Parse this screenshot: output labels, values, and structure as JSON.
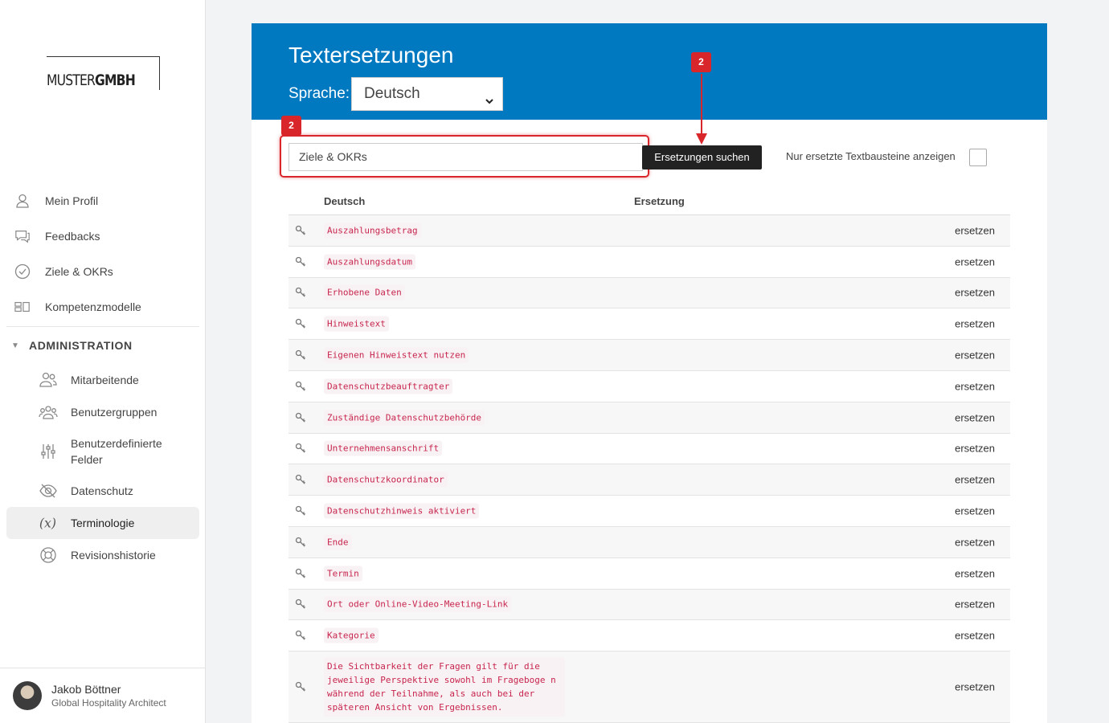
{
  "brand": {
    "logo_part1": "MUSTER",
    "logo_part2": "GMBH"
  },
  "nav": {
    "items": [
      {
        "label": "Mein Profil",
        "icon": "user-icon"
      },
      {
        "label": "Feedbacks",
        "icon": "chat-icon"
      },
      {
        "label": "Ziele & OKRs",
        "icon": "check-circle-icon"
      },
      {
        "label": "Kompetenzmodelle",
        "icon": "model-icon"
      }
    ],
    "admin_label": "ADMINISTRATION",
    "admin_items": [
      {
        "label": "Mitarbeitende",
        "icon": "people-icon"
      },
      {
        "label": "Benutzergruppen",
        "icon": "group-icon"
      },
      {
        "label": "Benutzerdefinierte Felder",
        "icon": "sliders-icon"
      },
      {
        "label": "Datenschutz",
        "icon": "eye-off-icon"
      },
      {
        "label": "Terminologie",
        "icon": "variable-icon",
        "active": true
      },
      {
        "label": "Revisionshistorie",
        "icon": "lifebuoy-icon"
      }
    ]
  },
  "user": {
    "name": "Jakob Böttner",
    "role": "Global Hospitality Architect"
  },
  "header": {
    "title": "Textersetzungen",
    "language_label": "Sprache:",
    "language_value": "Deutsch"
  },
  "search": {
    "value": "Ziele & OKRs",
    "button_label": "Ersetzungen suchen",
    "filter_label": "Nur ersetzte Textbausteine anzeigen"
  },
  "annotations": {
    "badge_top": "2",
    "badge_left": "2"
  },
  "table": {
    "headers": {
      "deutsch": "Deutsch",
      "ersetzung": "Ersetzung"
    },
    "action_label": "ersetzen",
    "rows": [
      "Auszahlungsbetrag",
      "Auszahlungsdatum",
      "Erhobene Daten",
      "Hinweistext",
      "Eigenen Hinweistext nutzen",
      "Datenschutzbeauftragter",
      "Zuständige Datenschutzbehörde",
      "Unternehmensanschrift",
      "Datenschutzkoordinator",
      "Datenschutzhinweis aktiviert",
      "Ende",
      "Termin",
      "Ort oder Online-Video-Meeting-Link",
      "Kategorie",
      "Die Sichtbarkeit der Fragen gilt für die jeweilige Perspektive sowohl im Frageboge n während der Teilnahme, als auch bei der späteren Ansicht von Ergebnissen."
    ]
  },
  "colors": {
    "header_bg": "#0079c1",
    "annotation_red": "#d9262b",
    "code_red": "#c7254e"
  }
}
